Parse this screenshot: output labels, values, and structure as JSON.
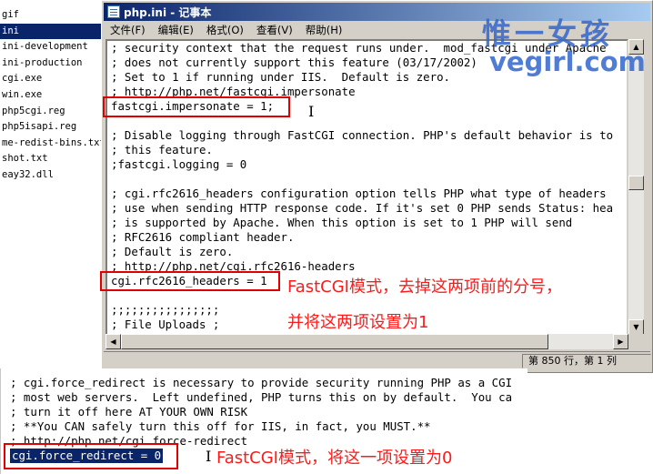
{
  "file_list": [
    "gif",
    "ini",
    "ini-development",
    "ini-production",
    "cgi.exe",
    "win.exe",
    "php5cgi.reg",
    "php5isapi.reg",
    "me-redist-bins.txt",
    "shot.txt",
    "eay32.dll"
  ],
  "file_list_selected": "ini",
  "window": {
    "title": "php.ini - 记事本"
  },
  "menu": [
    "文件(F)",
    "编辑(E)",
    "格式(O)",
    "查看(V)",
    "帮助(H)"
  ],
  "editor_lines": [
    "; security context that the request runs under.  mod_fastcgi under Apache",
    "; does not currently support this feature (03/17/2002)",
    "; Set to 1 if running under IIS.  Default is zero.",
    "; http://php.net/fastcgi.impersonate",
    "fastcgi.impersonate = 1;",
    "",
    "; Disable logging through FastCGI connection. PHP's default behavior is to",
    "; this feature.",
    ";fastcgi.logging = 0",
    "",
    "; cgi.rfc2616_headers configuration option tells PHP what type of headers",
    "; use when sending HTTP response code. If it's set 0 PHP sends Status: hea",
    "; is supported by Apache. When this option is set to 1 PHP will send",
    "; RFC2616 compliant header.",
    "; Default is zero.",
    "; http://php.net/cgi.rfc2616-headers",
    "cgi.rfc2616_headers = 1",
    "",
    ";;;;;;;;;;;;;;;;",
    "; File Uploads ;"
  ],
  "status": {
    "position": "第 850 行，第 1 列"
  },
  "lower_lines": [
    "; cgi.force_redirect is necessary to provide security running PHP as a CGI",
    "; most web servers.  Left undefined, PHP turns this on by default.  You ca",
    "; turn it off here AT YOUR OWN RISK",
    "; **You CAN safely turn this off for IIS, in fact, you MUST.**",
    "; http://php.net/cgi.force-redirect",
    "cgi.force_redirect = 0"
  ],
  "annotations": {
    "note1_line1": "FastCGI模式，去掉这两项前的分号，",
    "note1_line2": "并将这两项设置为1",
    "note2": "FastCGI模式，将这一项设置为0"
  },
  "watermark": {
    "cn": "惟一女孩",
    "en": "vegirl.com"
  },
  "colors": {
    "title_bar": "#0a246a",
    "annotation": "#e00000",
    "watermark": "#3366cc",
    "selection": "#0a246a"
  },
  "icons": {
    "title": "notepad-icon"
  }
}
